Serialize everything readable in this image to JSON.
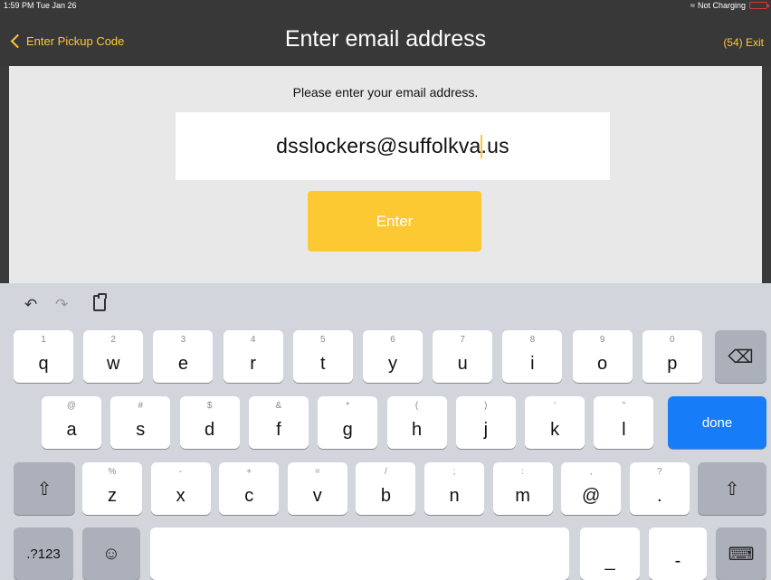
{
  "status_bar": {
    "time": "1:59 PM  Tue Jan 26",
    "charging": "Not Charging",
    "wifi_icon": "wifi-icon",
    "battery_icon": "battery-icon"
  },
  "nav": {
    "back_label": "Enter Pickup Code",
    "title": "Enter email address",
    "exit_label": "(54) Exit"
  },
  "form": {
    "prompt": "Please enter your email address.",
    "email_before_caret": "dsslockers@suffolkva",
    "email_after_caret": ".us",
    "submit_label": "Enter"
  },
  "keyboard": {
    "row1": [
      {
        "hint": "1",
        "ch": "q"
      },
      {
        "hint": "2",
        "ch": "w"
      },
      {
        "hint": "3",
        "ch": "e"
      },
      {
        "hint": "4",
        "ch": "r"
      },
      {
        "hint": "5",
        "ch": "t"
      },
      {
        "hint": "6",
        "ch": "y"
      },
      {
        "hint": "7",
        "ch": "u"
      },
      {
        "hint": "8",
        "ch": "i"
      },
      {
        "hint": "9",
        "ch": "o"
      },
      {
        "hint": "0",
        "ch": "p"
      }
    ],
    "row2": [
      {
        "hint": "@",
        "ch": "a"
      },
      {
        "hint": "#",
        "ch": "s"
      },
      {
        "hint": "$",
        "ch": "d"
      },
      {
        "hint": "&",
        "ch": "f"
      },
      {
        "hint": "*",
        "ch": "g"
      },
      {
        "hint": "(",
        "ch": "h"
      },
      {
        "hint": ")",
        "ch": "j"
      },
      {
        "hint": "'",
        "ch": "k"
      },
      {
        "hint": "\"",
        "ch": "l"
      }
    ],
    "row3": [
      {
        "hint": "%",
        "ch": "z"
      },
      {
        "hint": "-",
        "ch": "x"
      },
      {
        "hint": "+",
        "ch": "c"
      },
      {
        "hint": "=",
        "ch": "v"
      },
      {
        "hint": "/",
        "ch": "b"
      },
      {
        "hint": ";",
        "ch": "n"
      },
      {
        "hint": ":",
        "ch": "m"
      },
      {
        "hint": ",",
        "ch": "@"
      },
      {
        "hint": "?",
        "ch": "."
      }
    ],
    "done_label": "done",
    "numbers_label": ".?123",
    "underscore": "_",
    "dash": "-",
    "icons": {
      "undo": "undo-icon",
      "redo": "redo-icon",
      "paste": "paste-icon",
      "delete": "delete-icon",
      "shift": "shift-icon",
      "emoji": "emoji-icon",
      "dismiss": "keyboard-dismiss-icon"
    }
  },
  "colors": {
    "accent": "#fcc933",
    "done": "#167cf8",
    "topbar": "#383838",
    "card": "#e8e8e8",
    "keyboard": "#d2d5db"
  }
}
